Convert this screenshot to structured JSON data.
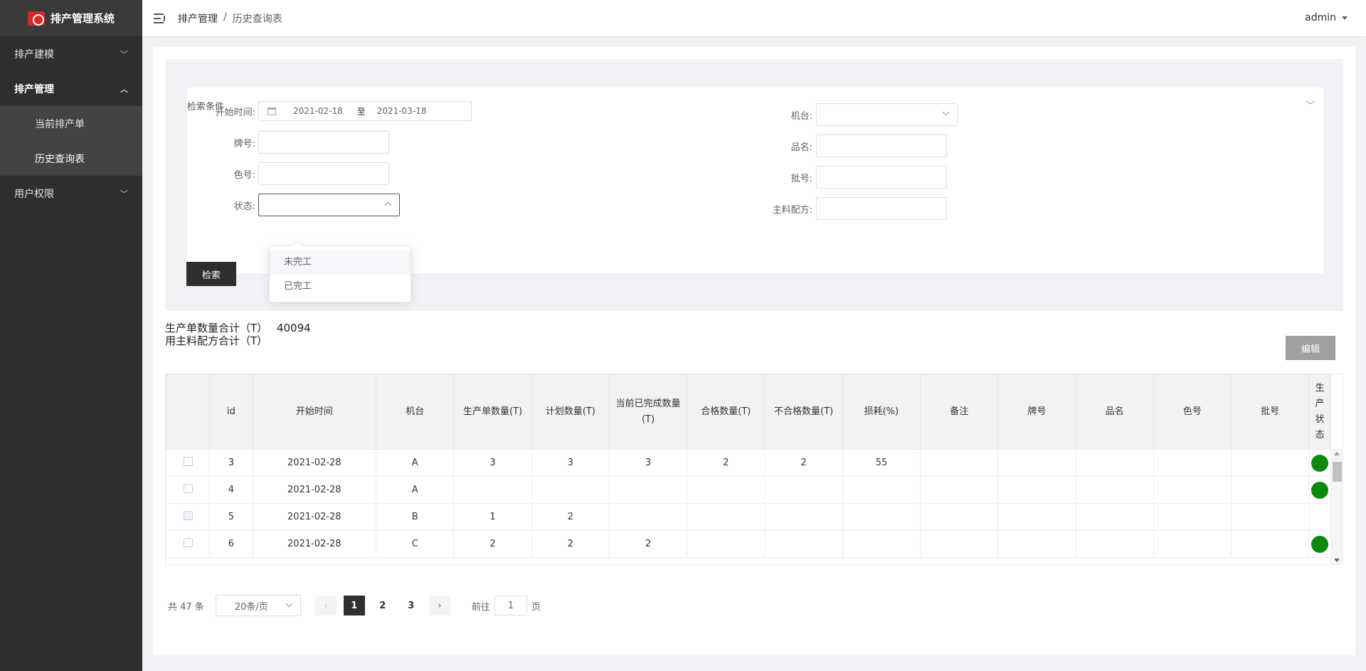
{
  "app": {
    "title": "排产管理系统",
    "user": "admin"
  },
  "sidebar": {
    "groups": [
      {
        "label": "排产建模"
      },
      {
        "label": "排产管理",
        "items": [
          {
            "label": "当前排产单"
          },
          {
            "label": "历史查询表"
          }
        ]
      },
      {
        "label": "用户权限"
      }
    ]
  },
  "breadcrumb": {
    "root": "排产管理",
    "sep": "/",
    "current": "历史查询表"
  },
  "search": {
    "title": "检索条件",
    "start_label": "开始时间:",
    "start_date": "2021-02-18",
    "range_sep": "至",
    "end_date": "2021-03-18",
    "brand_label": "牌号:",
    "color_label": "色号:",
    "status_label": "状态:",
    "machine_label": "机台:",
    "product_label": "品名:",
    "batch_label": "批号:",
    "formula_label": "主料配方:",
    "status_options": [
      "未完工",
      "已完工"
    ],
    "search_button": "检索"
  },
  "totals": {
    "order_qty_label": "生产单数量合计（T）",
    "order_qty_value": "40094",
    "formula_label": "用主料配方合计（T）"
  },
  "edit_button": "编辑",
  "table": {
    "headers": [
      "id",
      "开始时间",
      "机台",
      "生产单数量(T)",
      "计划数量(T)",
      "当前已完成数量(T)",
      "合格数量(T)",
      "不合格数量(T)",
      "损耗(%)",
      "备注",
      "牌号",
      "品名",
      "色号",
      "批号",
      "生产状态"
    ],
    "rows": [
      {
        "id": "3",
        "date": "2021-02-28",
        "machine": "A",
        "order": "3",
        "plan": "3",
        "done": "3",
        "ok": "2",
        "ng": "2",
        "loss": "55",
        "status": true
      },
      {
        "id": "4",
        "date": "2021-02-28",
        "machine": "A",
        "order": "",
        "plan": "",
        "done": "",
        "ok": "",
        "ng": "",
        "loss": "",
        "status": true
      },
      {
        "id": "5",
        "date": "2021-02-28",
        "machine": "B",
        "order": "1",
        "plan": "2",
        "done": "",
        "ok": "",
        "ng": "",
        "loss": "",
        "status": false
      },
      {
        "id": "6",
        "date": "2021-02-28",
        "machine": "C",
        "order": "2",
        "plan": "2",
        "done": "2",
        "ok": "",
        "ng": "",
        "loss": "",
        "status": true
      }
    ],
    "status_color": "#0d8a0d"
  },
  "pagination": {
    "total": "共 47 条",
    "page_size": "20条/页",
    "pages": [
      "1",
      "2",
      "3"
    ],
    "current": "1",
    "goto_label": "前往",
    "goto_value": "1",
    "page_unit": "页"
  }
}
